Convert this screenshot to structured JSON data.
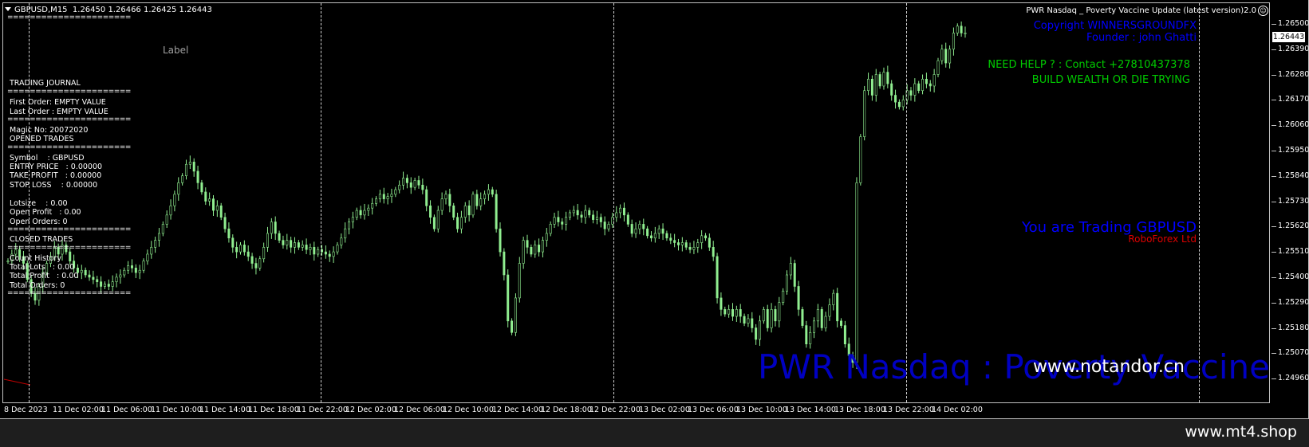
{
  "chart_header": {
    "symbol_timeframe": "GBPUSD,M15",
    "ohlc": "1.26450 1.26466 1.26425 1.26443"
  },
  "ea": {
    "title": "PWR Nasdaq _ Poverty Vaccine Update (latest version)2.0",
    "smiley": "☺"
  },
  "journal": {
    "separator": "======================",
    "trading_journal": "TRADING JOURNAL",
    "first_order": "First Order: EMPTY VALUE",
    "last_order": "Last Order : EMPTY VALUE",
    "magic_no": "Magic No: 20072020",
    "opened_trades": "OPENED TRADES",
    "symbol": "Symbol    : GBPUSD",
    "entry_price": "ENTRY PRICE   : 0.00000",
    "take_profit": "TAKE PROFIT   : 0.00000",
    "stop_loss": "STOP LOSS    : 0.00000",
    "lotsize": "Lotsize    : 0.00",
    "open_profit": "Open Profit   : 0.00",
    "open_orders": "Open Orders: 0",
    "closed_trades": "CLOSED TRADES",
    "count_history": "Count History",
    "total_lots": "Total Lots   : 0.00",
    "total_profit": "Total Profit   : 0.00",
    "total_orders": "Total Orders: 0"
  },
  "label_text": "Label",
  "right_panel": {
    "copyright": "Copyright WINNERSGROUNDFX",
    "founder": "Founder : john Ghatti",
    "help": "NEED HELP ? : Contact +27810437378",
    "motto": "BUILD WEALTH OR DIE TRYING",
    "trading": "You are Trading GBPUSD",
    "broker": "RoboForex Ltd"
  },
  "watermark": "PWR Nasdaq : Poverty Vaccine",
  "url_overlay": "www.notandor.cn",
  "price_axis": {
    "labels": [
      "1.26500",
      "1.26390",
      "1.26280",
      "1.26170",
      "1.26060",
      "1.25950",
      "1.25840",
      "1.25730",
      "1.25620",
      "1.25510",
      "1.25400",
      "1.25290",
      "1.25180",
      "1.25070",
      "1.24960"
    ],
    "current": "1.26443"
  },
  "time_axis": {
    "labels": [
      "8 Dec 2023",
      "11 Dec 02:00",
      "11 Dec 06:00",
      "11 Dec 10:00",
      "11 Dec 14:00",
      "11 Dec 18:00",
      "11 Dec 22:00",
      "12 Dec 02:00",
      "12 Dec 06:00",
      "12 Dec 10:00",
      "12 Dec 14:00",
      "12 Dec 18:00",
      "12 Dec 22:00",
      "13 Dec 02:00",
      "13 Dec 06:00",
      "13 Dec 10:00",
      "13 Dec 14:00",
      "13 Dec 18:00",
      "13 Dec 22:00",
      "14 Dec 02:00"
    ]
  },
  "footer": {
    "url": "www.mt4.shop"
  },
  "colors": {
    "candle": "#90ee90",
    "copyright": "#0000ff",
    "help": "#00cc00",
    "trading": "#0000ff",
    "broker": "#dd0000",
    "watermark": "#0000cc"
  },
  "chart_data": {
    "type": "candlestick",
    "series": [
      {
        "values": [
          1.2546,
          1.2549,
          1.2551,
          1.2548,
          1.2545,
          1.2538,
          1.2532,
          1.2529,
          1.2535,
          1.2541,
          1.2545,
          1.2548,
          1.2552,
          1.2549,
          1.2553,
          1.255,
          1.2546,
          1.2543,
          1.2541,
          1.2542,
          1.254,
          1.2539,
          1.2538,
          1.2537,
          1.2535,
          1.2536,
          1.2535,
          1.2537,
          1.2539,
          1.254,
          1.2542,
          1.2544,
          1.2543,
          1.2541,
          1.2542,
          1.2546,
          1.2549,
          1.2552,
          1.2555,
          1.2558,
          1.2562,
          1.2566,
          1.257,
          1.2575,
          1.258,
          1.2583,
          1.2588,
          1.2589,
          1.2585,
          1.258,
          1.2576,
          1.2572,
          1.2573,
          1.2568,
          1.257,
          1.2565,
          1.256,
          1.2556,
          1.2552,
          1.255,
          1.2553,
          1.255,
          1.2548,
          1.2545,
          1.2543,
          1.2547,
          1.2552,
          1.2558,
          1.2563,
          1.2558,
          1.2555,
          1.2553,
          1.2555,
          1.2552,
          1.2554,
          1.2552,
          1.2553,
          1.2551,
          1.2552,
          1.2549,
          1.2551,
          1.255,
          1.2549,
          1.2548,
          1.255,
          1.2553,
          1.2556,
          1.256,
          1.2563,
          1.2565,
          1.2568,
          1.2566,
          1.2568,
          1.2569,
          1.2571,
          1.2573,
          1.2575,
          1.2573,
          1.2574,
          1.2575,
          1.2577,
          1.2579,
          1.2582,
          1.258,
          1.2578,
          1.2581,
          1.2579,
          1.2577,
          1.257,
          1.2565,
          1.256,
          1.2568,
          1.2573,
          1.2575,
          1.257,
          1.2565,
          1.256,
          1.2565,
          1.257,
          1.2566,
          1.2575,
          1.257,
          1.2573,
          1.2575,
          1.2577,
          1.2575,
          1.256,
          1.255,
          1.254,
          1.252,
          1.2515,
          1.253,
          1.2545,
          1.2555,
          1.2552,
          1.2549,
          1.2553,
          1.255,
          1.2555,
          1.2558,
          1.2562,
          1.2565,
          1.2563,
          1.2562,
          1.2565,
          1.2567,
          1.2568,
          1.2566,
          1.2565,
          1.2568,
          1.2566,
          1.2564,
          1.2565,
          1.2563,
          1.256,
          1.2562,
          1.2565,
          1.2567,
          1.2569,
          1.2566,
          1.2562,
          1.2558,
          1.256,
          1.2562,
          1.256,
          1.2557,
          1.2556,
          1.2558,
          1.256,
          1.2558,
          1.2556,
          1.2555,
          1.2554,
          1.2553,
          1.2554,
          1.2552,
          1.2551,
          1.2552,
          1.2554,
          1.2557,
          1.2556,
          1.2552,
          1.2548,
          1.253,
          1.2525,
          1.2523,
          1.2525,
          1.2522,
          1.2525,
          1.2522,
          1.2519,
          1.2521,
          1.2517,
          1.2512,
          1.252,
          1.2525,
          1.2517,
          1.2525,
          1.252,
          1.2528,
          1.2533,
          1.254,
          1.2545,
          1.2535,
          1.2525,
          1.2518,
          1.251,
          1.2515,
          1.252,
          1.2525,
          1.2517,
          1.2522,
          1.2527,
          1.2532,
          1.252,
          1.2518,
          1.251,
          1.2505,
          1.2502,
          1.258,
          1.26,
          1.262,
          1.2625,
          1.2618,
          1.2627,
          1.2622,
          1.2628,
          1.2623,
          1.2618,
          1.2615,
          1.2613,
          1.2616,
          1.262,
          1.2618,
          1.2623,
          1.262,
          1.2625,
          1.2623,
          1.2622,
          1.2627,
          1.2633,
          1.2638,
          1.2632,
          1.2638,
          1.2645,
          1.2648,
          1.2645,
          1.2645
        ]
      }
    ],
    "ylim": [
      1.2496,
      1.265
    ]
  }
}
